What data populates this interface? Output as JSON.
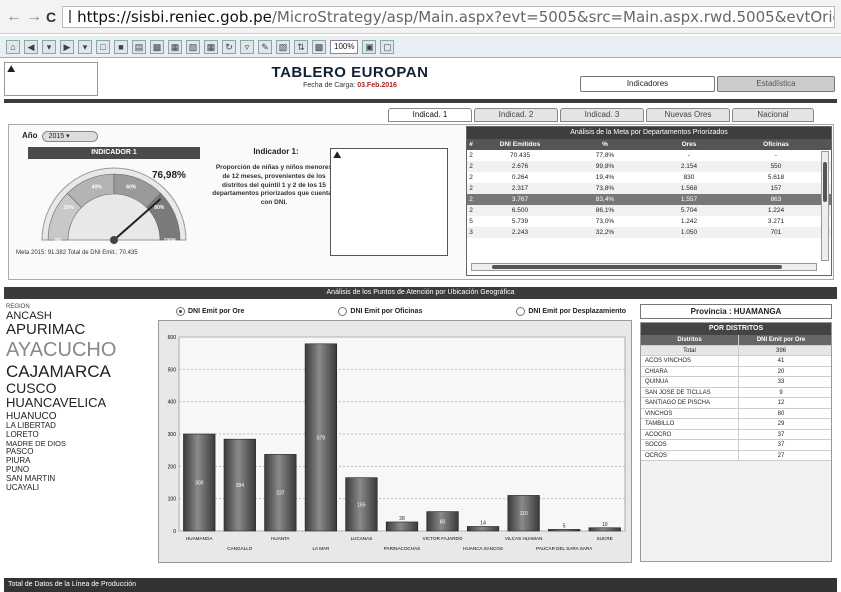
{
  "browser": {
    "host": "https://sisbi.reniec.gob.pe",
    "path": "/MicroStrategy/asp/Main.aspx?evt=5005&src=Main.aspx.rwd.5005&evtOrigin=fromWait&Main.aspx"
  },
  "toolbar": {
    "zoom": "100%"
  },
  "header": {
    "title": "TABLERO EUROPAN",
    "subtitle_label": "Fecha de Carga:",
    "subtitle_value": "03.Feb.2016",
    "btn_indicadores": "Indicadores",
    "btn_estadistica": "Estadística"
  },
  "tabs": [
    "Indicad. 1",
    "Indicad. 2",
    "Indicad. 3",
    "Nuevas Ores",
    "Nacional"
  ],
  "indicator": {
    "year_label": "Año",
    "year_value": "2015",
    "bar_label": "INDICADOR 1",
    "gauge_value": 0.7698,
    "gauge_pct_text": "76,98%",
    "gauge_ticks": [
      "0%",
      "20%",
      "40%",
      "60%",
      "80%",
      "100%"
    ],
    "meta_text": "Meta 2015: 91.382   Total de DNI Emit.:  70.435",
    "desc_title": "Indicador 1:",
    "desc_text": "Proporción de niñas y niños menores de 12 meses, provenientes de los distritos del quintil 1 y 2 de los 15 departamentos priorizados que cuentan con DNI."
  },
  "meta_table": {
    "title": "Análisis de la Meta por Departamentos Priorizados",
    "headers": [
      "#",
      "DNI Emitidos",
      "%",
      "Ores",
      "Oficinas"
    ],
    "rows": [
      [
        "2",
        "70.435",
        "77,8%",
        "-",
        "-"
      ],
      [
        "2",
        "2.676",
        "99,8%",
        "2.154",
        "550"
      ],
      [
        "2",
        "0.264",
        "19,4%",
        "830",
        "5.618"
      ],
      [
        "2",
        "2.317",
        "73,8%",
        "1.568",
        "157"
      ],
      [
        "2",
        "3.767",
        "83,4%",
        "1.557",
        "863"
      ],
      [
        "2",
        "6.500",
        "86,1%",
        "5.704",
        "1.224"
      ],
      [
        "5",
        "5.739",
        "73,0%",
        "1.242",
        "3.271"
      ],
      [
        "3",
        "2.243",
        "32,2%",
        "1.050",
        "701"
      ]
    ],
    "selected_row": 4
  },
  "analysis": {
    "title": "Análisis de los Puntos de Atención por Ubicación Geográfica",
    "radios": [
      "DNI Emit por Ore",
      "DNI Emit por Oficinas",
      "DNI Emit por Desplazamiento"
    ],
    "selected_radio": 0
  },
  "regions": {
    "header": "REGION",
    "items": [
      {
        "name": "ANCASH",
        "size": 11
      },
      {
        "name": "APURIMAC",
        "size": 15
      },
      {
        "name": "AYACUCHO",
        "size": 20,
        "color": "#888888"
      },
      {
        "name": "CAJAMARCA",
        "size": 17
      },
      {
        "name": "CUSCO",
        "size": 14
      },
      {
        "name": "HUANCAVELICA",
        "size": 13
      },
      {
        "name": "HUANUCO",
        "size": 10
      },
      {
        "name": "LA LIBERTAD",
        "size": 8
      },
      {
        "name": "LORETO",
        "size": 8
      },
      {
        "name": "MADRE DE DIOS",
        "size": 7.5
      },
      {
        "name": "PASCO",
        "size": 8
      },
      {
        "name": "PIURA",
        "size": 8
      },
      {
        "name": "PUNO",
        "size": 8
      },
      {
        "name": "SAN MARTIN",
        "size": 8
      },
      {
        "name": "UCAYALI",
        "size": 8
      }
    ]
  },
  "chart_data": {
    "type": "bar",
    "categories": [
      "HUAMANGA",
      "CANGALLO",
      "HUANTA",
      "LA MAR",
      "LUCANAS",
      "PARINACOCHAS",
      "VICTOR FAJARDO",
      "HUANCA SANCOS",
      "VILCAS HUAMAN",
      "PAUCAR DEL SARA SARA",
      "SUCRE"
    ],
    "values": [
      300,
      284,
      237,
      579,
      165,
      28,
      60,
      14,
      110,
      5,
      10
    ],
    "ylim": [
      0,
      600
    ],
    "yticks": [
      "0",
      "100",
      "200",
      "300",
      "400",
      "500",
      "600"
    ],
    "grid": true
  },
  "province": {
    "label": "Provincia : HUAMANGA",
    "table_title": "POR DISTRITOS",
    "headers": [
      "Distritos",
      "DNI Emit por Ore"
    ],
    "rows": [
      [
        "Total",
        "396"
      ],
      [
        "ACOS VINCHOS",
        "41"
      ],
      [
        "CHIARA",
        "20"
      ],
      [
        "QUINUA",
        "33"
      ],
      [
        "SAN JOSE DE TICLLAS",
        "9"
      ],
      [
        "SANTIAGO DE PISCHA",
        "12"
      ],
      [
        "VINCHOS",
        "80"
      ],
      [
        "TAMBILLO",
        "29"
      ],
      [
        "ACOCRO",
        "37"
      ],
      [
        "SOCOS",
        "37"
      ],
      [
        "OCROS",
        "27"
      ]
    ]
  },
  "footer": "Total de Datos de la Línea de Producción"
}
